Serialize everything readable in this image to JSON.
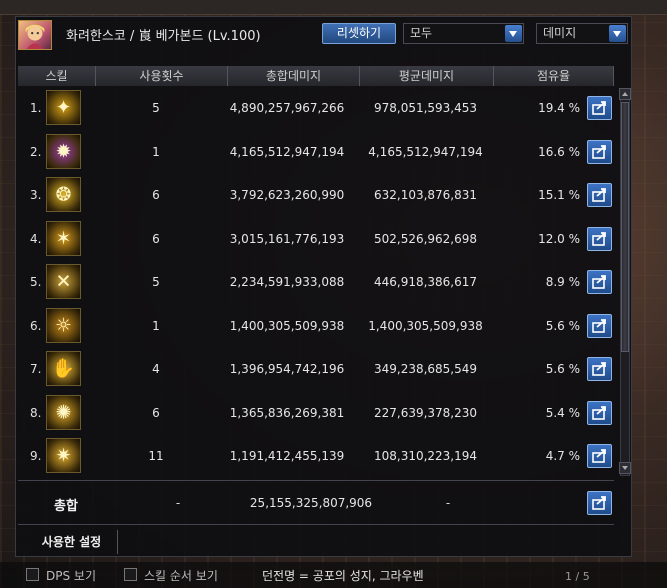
{
  "character": {
    "name": "화려한스코 / 崀 베가본드 (Lv.100)"
  },
  "controls": {
    "reset_label": "리셋하기",
    "filter_selected": "모두",
    "metric_selected": "데미지"
  },
  "table": {
    "columns": [
      "스킬",
      "사용횟수",
      "총합데미지",
      "평균데미지",
      "점유율"
    ],
    "rows": [
      {
        "index": "1.",
        "uses": "5",
        "total": "4,890,257,967,266",
        "avg": "978,051,593,453",
        "share": "19.4 %",
        "icon_color": "#d4a017"
      },
      {
        "index": "2.",
        "uses": "1",
        "total": "4,165,512,947,194",
        "avg": "4,165,512,947,194",
        "share": "16.6 %",
        "icon_color": "#9b3fa6"
      },
      {
        "index": "3.",
        "uses": "6",
        "total": "3,792,623,260,990",
        "avg": "632,103,876,831",
        "share": "15.1 %",
        "icon_color": "#e0b52a"
      },
      {
        "index": "4.",
        "uses": "6",
        "total": "3,015,161,776,193",
        "avg": "502,526,962,698",
        "share": "12.0 %",
        "icon_color": "#d49a1c"
      },
      {
        "index": "5.",
        "uses": "5",
        "total": "2,234,591,933,088",
        "avg": "446,918,386,617",
        "share": "8.9 %",
        "icon_color": "#caa23a"
      },
      {
        "index": "6.",
        "uses": "1",
        "total": "1,400,305,509,938",
        "avg": "1,400,305,509,938",
        "share": "5.6 %",
        "icon_color": "#c98a1a"
      },
      {
        "index": "7.",
        "uses": "4",
        "total": "1,396,954,742,196",
        "avg": "349,238,685,549",
        "share": "5.6 %",
        "icon_color": "#e2b93b"
      },
      {
        "index": "8.",
        "uses": "6",
        "total": "1,365,836,269,381",
        "avg": "227,639,378,230",
        "share": "5.4 %",
        "icon_color": "#d8a628"
      },
      {
        "index": "9.",
        "uses": "11",
        "total": "1,191,412,455,139",
        "avg": "108,310,223,194",
        "share": "4.7 %",
        "icon_color": "#e0ad30"
      }
    ]
  },
  "summary": {
    "label": "총합",
    "uses": "-",
    "total": "25,155,325,807,906",
    "avg": "-"
  },
  "tabs": {
    "active": "사용한 설정"
  },
  "footer": {
    "dps_label": "DPS 보기",
    "skill_order_label": "스킬 순서 보기",
    "dungeon": "던전명 = 공포의 성지, 그라우벤",
    "page": "1 / 5"
  },
  "colors": {
    "accent": "#2f5ea5",
    "panel_bg": "#0e0e11"
  }
}
